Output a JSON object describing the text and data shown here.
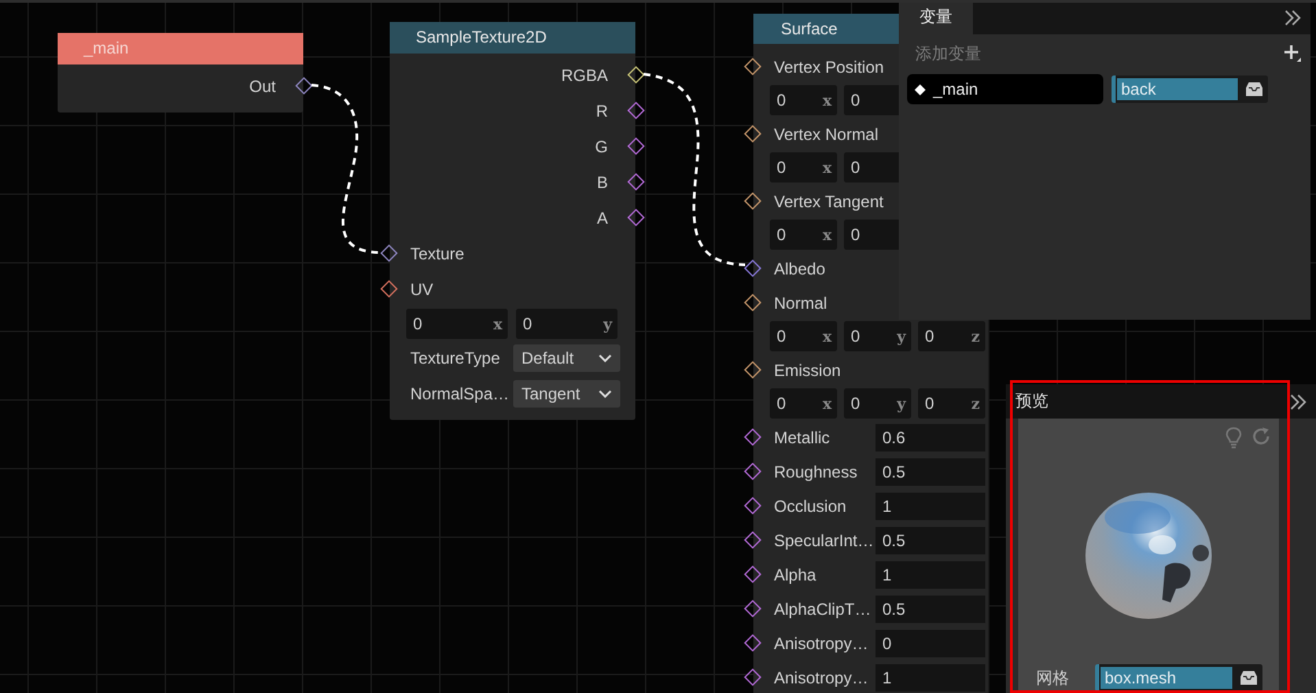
{
  "nodes": [
    {
      "kind": "main",
      "title": "_main",
      "color": "#e57368",
      "rows": [
        {
          "kind": "output",
          "label": "Out",
          "color": "#8e86c0"
        }
      ]
    },
    {
      "kind": "sample",
      "title": "SampleTexture2D",
      "color": "#2b4f5c",
      "rows": [
        {
          "kind": "output",
          "label": "RGBA",
          "color": "#c8c477"
        },
        {
          "kind": "output",
          "label": "R",
          "color": "#b36ad6"
        },
        {
          "kind": "output",
          "label": "G",
          "color": "#b36ad6"
        },
        {
          "kind": "output",
          "label": "B",
          "color": "#b36ad6"
        },
        {
          "kind": "output",
          "label": "A",
          "color": "#b36ad6"
        },
        {
          "kind": "input",
          "label": "Texture",
          "color": "#8e86c0"
        },
        {
          "kind": "input",
          "label": "UV",
          "color": "#d5705e"
        },
        {
          "kind": "fields",
          "fields": [
            {
              "value": "0",
              "axis": "x"
            },
            {
              "value": "0",
              "axis": "y"
            }
          ]
        },
        {
          "kind": "select",
          "label": "TextureType",
          "value": "Default"
        },
        {
          "kind": "select",
          "label": "NormalSpa…",
          "value": "Tangent"
        }
      ]
    },
    {
      "kind": "surface",
      "title": "Surface",
      "color": "#2c5566",
      "rows": [
        {
          "kind": "input",
          "label": "Vertex Position",
          "color": "#c4956a"
        },
        {
          "kind": "fields",
          "fields": [
            {
              "value": "0",
              "axis": "x"
            },
            {
              "value": "0"
            }
          ]
        },
        {
          "kind": "input",
          "label": "Vertex Normal",
          "color": "#c4956a"
        },
        {
          "kind": "fields",
          "fields": [
            {
              "value": "0",
              "axis": "x"
            },
            {
              "value": "0"
            }
          ]
        },
        {
          "kind": "input",
          "label": "Vertex Tangent",
          "color": "#c4956a"
        },
        {
          "kind": "fields",
          "fields": [
            {
              "value": "0",
              "axis": "x"
            },
            {
              "value": "0"
            }
          ]
        },
        {
          "kind": "input",
          "label": "Albedo",
          "color": "#8878d8"
        },
        {
          "kind": "input",
          "label": "Normal",
          "color": "#c4956a"
        },
        {
          "kind": "fields",
          "fields": [
            {
              "value": "0",
              "axis": "x"
            },
            {
              "value": "0",
              "axis": "y"
            },
            {
              "value": "0",
              "axis": "z"
            }
          ]
        },
        {
          "kind": "input",
          "label": "Emission",
          "color": "#c4956a"
        },
        {
          "kind": "fields",
          "fields": [
            {
              "value": "0",
              "axis": "x"
            },
            {
              "value": "0",
              "axis": "y"
            },
            {
              "value": "0",
              "axis": "z"
            }
          ]
        },
        {
          "kind": "float",
          "label": "Metallic",
          "color": "#b36ad6",
          "value": "0.6"
        },
        {
          "kind": "float",
          "label": "Roughness",
          "color": "#b36ad6",
          "value": "0.5"
        },
        {
          "kind": "float",
          "label": "Occlusion",
          "color": "#b36ad6",
          "value": "1"
        },
        {
          "kind": "float",
          "label": "SpecularInt…",
          "color": "#b36ad6",
          "value": "0.5"
        },
        {
          "kind": "float",
          "label": "Alpha",
          "color": "#b36ad6",
          "value": "1"
        },
        {
          "kind": "float",
          "label": "AlphaClipT…",
          "color": "#b36ad6",
          "value": "0.5"
        },
        {
          "kind": "float",
          "label": "Anisotropy…",
          "color": "#b36ad6",
          "value": "0"
        },
        {
          "kind": "float",
          "label": "Anisotropy…",
          "color": "#b36ad6",
          "value": "1"
        }
      ]
    }
  ],
  "variables_panel": {
    "tabs": [
      {
        "label": "变量",
        "selected": true
      }
    ],
    "add_label": "添加变量",
    "variables": [
      {
        "name": "_main",
        "type": "back"
      }
    ]
  },
  "preview_panel": {
    "title": "预览",
    "highlighted": true,
    "mesh_label": "网格",
    "mesh": "box.mesh"
  }
}
